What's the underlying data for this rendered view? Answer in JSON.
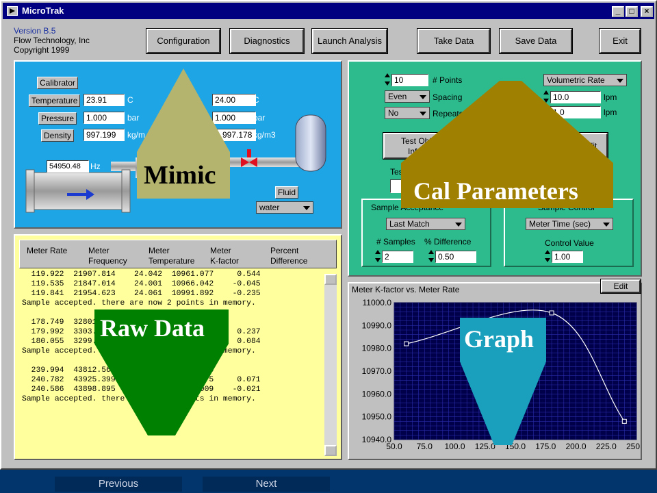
{
  "window": {
    "title": "MicroTrak"
  },
  "info": {
    "version": "Version B.5",
    "company": "Flow Technology, Inc",
    "copyright": "Copyright 1999"
  },
  "toolbar": {
    "configuration": "Configuration",
    "diagnostics": "Diagnostics",
    "launch_analysis": "Launch Analysis",
    "take_data": "Take Data",
    "save_data": "Save Data",
    "exit": "Exit"
  },
  "mimic": {
    "calibrator_label": "Calibrator",
    "meter_label": "M...r",
    "temperature_label": "Temperature",
    "pressure_label": "Pressure",
    "density_label": "Density",
    "meter_temperature_label": "Te...",
    "cal_temperature": "23.91",
    "cal_pressure": "1.000",
    "cal_density": "997.199",
    "meter_temperature": "24.00",
    "meter_pressure": "1.000",
    "meter_density": "997.178",
    "unit_c": "C",
    "unit_bar": "bar",
    "unit_density": "kg/m3",
    "unit_density_partial": "kg/m",
    "frequency": "54950.48",
    "unit_hz": "Hz",
    "fluid_label": "Fluid",
    "fluid_value": "water"
  },
  "cal": {
    "num_points": "10",
    "num_points_label": "# Points",
    "spacing_value": "Even",
    "spacing_label": "Spacing",
    "repeats_value": "No",
    "repeats_label": "Repeats",
    "rate_type": "Volumetric Rate",
    "high_label": "gh",
    "high_value": "10.0",
    "low_value": "1.0",
    "unit_lpm": "lpm",
    "test_obj_line1": "Test Obj",
    "test_obj_line2": "Infor",
    "edit_partial": "dit",
    "tes_label": "Tes",
    "sample_acceptance_title": "Sample Acceptance",
    "sample_acceptance_value": "Last Match",
    "num_samples_label": "# Samples",
    "num_samples_value": "2",
    "pct_diff_label": "% Difference",
    "pct_diff_value": "0.50",
    "sample_control_title": "Sample Control",
    "sample_control_value": "Meter Time (sec)",
    "control_value_label": "Control Value",
    "control_value": "1.00"
  },
  "raw": {
    "headers": [
      {
        "line1": "Meter Rate",
        "line2": ""
      },
      {
        "line1": "Meter",
        "line2": "Frequency"
      },
      {
        "line1": "Meter",
        "line2": "Temperature"
      },
      {
        "line1": "Meter",
        "line2": "K-factor"
      },
      {
        "line1": "Percent",
        "line2": "Difference"
      }
    ],
    "lines": [
      "  119.922  21907.814    24.042  10961.077     0.544",
      "  119.535  21847.014    24.001  10966.042    -0.045",
      "  119.841  21954.623    24.061  10991.892    -0.235",
      "Sample accepted. there are now 2 points in memory.",
      "",
      "  178.749  32801....             10985.749",
      "  179.992  3303...              10985.722     0.237",
      "  180.055  3299...              10985.443     0.084",
      "Sample accepted. there are now 3 points in memory.",
      "",
      "  239.994  43812.56...          10953.438",
      "  240.782  43925.399    ...     10945.675     0.071",
      "  240.586  43898.895    ...35   10948.009    -0.021",
      "Sample accepted. there are now 4 points in memory."
    ]
  },
  "graph": {
    "title": "Meter K-factor vs. Meter Rate",
    "edit_label": "Edit"
  },
  "chart_data": {
    "type": "line",
    "title": "Meter K-factor vs. Meter Rate",
    "xlabel": "",
    "ylabel": "",
    "xlim": [
      50,
      250
    ],
    "ylim": [
      10940,
      11000
    ],
    "xticks": [
      "50.0",
      "75.0",
      "100.0",
      "125.0",
      "150.0",
      "175.0",
      "200.0",
      "225.0",
      "250.0"
    ],
    "yticks": [
      "11000.0",
      "10990.0",
      "10980.0",
      "10970.0",
      "10960.0",
      "10950.0",
      "10940.0"
    ],
    "grid": true,
    "points": [
      {
        "x": 60,
        "y": 10982
      },
      {
        "x": 180,
        "y": 10995.5
      },
      {
        "x": 240,
        "y": 10948
      }
    ],
    "background_color": "#00004a",
    "line_color": "#ffffff"
  },
  "callouts": {
    "mimic": "Mimic",
    "cal_parameters": "Cal Parameters",
    "raw_data": "Raw Data",
    "graph": "Graph"
  },
  "nav": {
    "previous": "Previous",
    "next": "Next"
  },
  "colors": {
    "mimic_bg": "#1ea5e6",
    "cal_bg": "#2dba8c",
    "raw_bg": "#ffff9e",
    "callout_mimic": "#b4b46e",
    "callout_cal": "#a08000",
    "callout_raw": "#008000",
    "callout_graph": "#1aa0bd"
  }
}
